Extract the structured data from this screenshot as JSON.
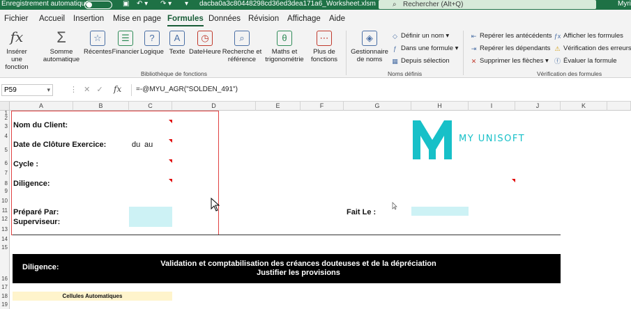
{
  "titlebar": {
    "autosave": "Enregistrement automatique",
    "filename": "dacba0a3c80448298cd36ed3dea171a6_Worksheet.xlsm",
    "search_placeholder": "Rechercher (Alt+Q)",
    "user": "Myri"
  },
  "tabs": [
    "Fichier",
    "Accueil",
    "Insertion",
    "Mise en page",
    "Formules",
    "Données",
    "Révision",
    "Affichage",
    "Aide"
  ],
  "active_tab": "Formules",
  "ribbon": {
    "insert_function": "Insérer une fonction",
    "autosum": "Somme automatique",
    "recent": "Récentes",
    "financial": "Financier",
    "logical": "Logique",
    "text": "Texte",
    "datetime": "DateHeure",
    "lookup": "Recherche et référence",
    "math": "Maths et trigonométrie",
    "more": "Plus de fonctions",
    "library_label": "Bibliothèque de fonctions",
    "name_manager": "Gestionnaire de noms",
    "define_name": "Définir un nom",
    "use_in_formula": "Dans une formule",
    "create_from_selection": "Depuis sélection",
    "names_label": "Noms définis",
    "trace_precedents": "Repérer les antécédents",
    "trace_dependents": "Repérer les dépendants",
    "remove_arrows": "Supprimer les flèches",
    "show_formulas": "Afficher les formules",
    "error_checking": "Vérification des erreurs",
    "evaluate_formula": "Évaluer la formule",
    "audit_label": "Vérification des formules"
  },
  "formula_bar": {
    "cell_ref": "P59",
    "formula": "=-@MYU_AGR(\"SOLDEN_491\")"
  },
  "columns": [
    "A",
    "B",
    "C",
    "D",
    "E",
    "F",
    "G",
    "H",
    "I",
    "J",
    "K"
  ],
  "rows": [
    "1",
    "2",
    "3",
    "4",
    "5",
    "6",
    "7",
    "8",
    "9",
    "10",
    "11",
    "12",
    "13",
    "14",
    "15",
    "16",
    "17",
    "18",
    "19"
  ],
  "sheet": {
    "client_label": "Nom du Client:",
    "closing_label": "Date de Clôture Exercice:",
    "du": "du",
    "au": "au",
    "cycle_label": "Cycle :",
    "diligence_label": "Diligence:",
    "prepared_label": "Préparé Par:",
    "supervisor_label": "Superviseur:",
    "done_label": "Fait Le :",
    "logo_text": "MY UNISOFT",
    "banner_label": "Diligence:",
    "banner_title_1": "Validation et comptabilisation des créances douteuses et de la dépréciation",
    "banner_title_2": "Justifier les provisions",
    "auto_cells": "Cellules Automatiques"
  },
  "colors": {
    "excel_green": "#1e7145",
    "logo_cyan": "#17c0c8",
    "input_cyan": "#cdf2f5",
    "auto_yellow": "#fff4cc"
  }
}
